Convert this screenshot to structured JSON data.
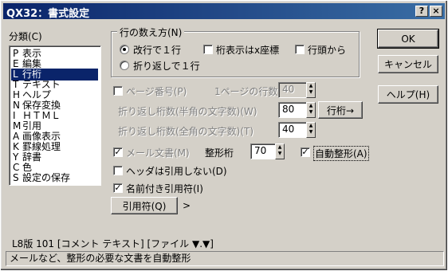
{
  "window": {
    "title": "QX32：書式設定",
    "help_btn": "?",
    "close_btn": "×"
  },
  "category": {
    "label": "分類(C)",
    "items": [
      {
        "key": "P",
        "label": "表示"
      },
      {
        "key": "E",
        "label": "編集"
      },
      {
        "key": "L",
        "label": "行桁"
      },
      {
        "key": "T",
        "label": "テキスト"
      },
      {
        "key": "H",
        "label": "ヘルプ"
      },
      {
        "key": "N",
        "label": "保存変換"
      },
      {
        "key": "I",
        "label": "ＨＴＭＬ"
      },
      {
        "key": "M",
        "label": "引用"
      },
      {
        "key": "A",
        "label": "画像表示"
      },
      {
        "key": "K",
        "label": "罫線処理"
      },
      {
        "key": "Y",
        "label": "辞書"
      },
      {
        "key": "C",
        "label": "色"
      },
      {
        "key": "S",
        "label": "設定の保存"
      }
    ],
    "selected_index": 2
  },
  "line_count": {
    "group_label": "行の数え方(N)",
    "radio_crlf": "改行で１行",
    "radio_wrap": "折り返しで１行",
    "chk_xcoord": "桁表示はx座標",
    "chk_from_top": "行頭から"
  },
  "page": {
    "chk_label": "ページ番号(P)",
    "lines_per_page_label": "1ページの行数",
    "lines_per_page_value": "40"
  },
  "wrap": {
    "chars_label": "折り返し桁数(半角の文字数)(W)",
    "chars_value": "80",
    "col_button": "行桁→",
    "indent_label": "折り返し桁数(全角の文字数)(T)",
    "indent_value": "40"
  },
  "mail": {
    "chk_label": "メール文書(M)",
    "format_label": "整形桁",
    "format_value": "70",
    "auto_label": "自動整形(A)"
  },
  "header": {
    "chk_label": "ヘッダは引用しない(D)"
  },
  "quote": {
    "chk_label": "名前付き引用符(I)",
    "button": "引用符(Q)",
    "arrow": ">"
  },
  "buttons": {
    "ok": "OK",
    "cancel": "キャンセル",
    "help": "ヘルプ(H)"
  },
  "info_line": "L8版 101 [コメント テキスト] [ファイル ▼.▼]",
  "status_text": "メールなど、整形の必要な文書を自動整形"
}
